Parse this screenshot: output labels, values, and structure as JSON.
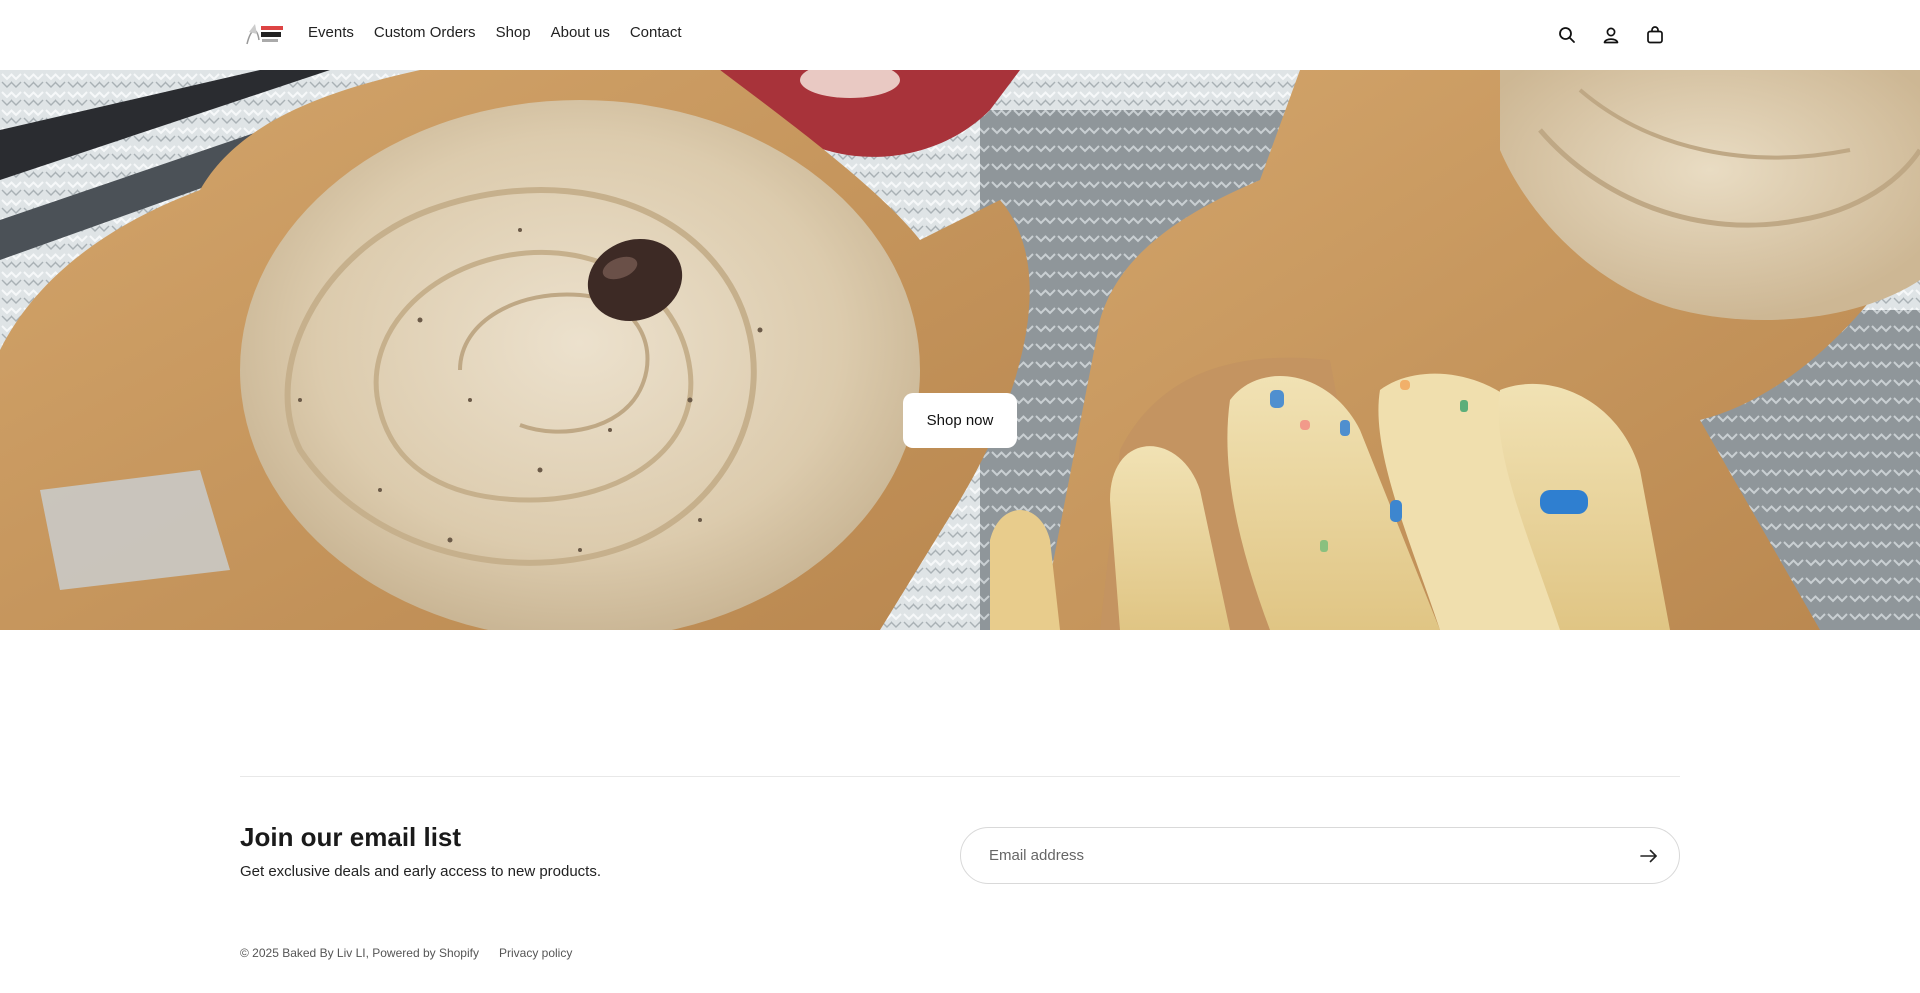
{
  "header": {
    "logo_alt": "Baked By Liv",
    "nav": [
      {
        "label": "Events"
      },
      {
        "label": "Custom Orders"
      },
      {
        "label": "Shop"
      },
      {
        "label": "About us"
      },
      {
        "label": "Contact"
      }
    ],
    "icons": [
      "search-icon",
      "account-icon",
      "cart-icon"
    ]
  },
  "hero": {
    "cta_label": "Shop now",
    "slides_total": 2,
    "active_slide": 1
  },
  "newsletter": {
    "title": "Join our email list",
    "subtitle": "Get exclusive deals and early access to new products.",
    "email_placeholder": "Email address"
  },
  "footer": {
    "copyright": "© 2025 Baked By Liv LI, Powered by Shopify",
    "privacy_label": "Privacy policy"
  },
  "colors": {
    "accent_dot_active": "#bcd3e3",
    "background": "#ffffff",
    "text": "#222222"
  }
}
